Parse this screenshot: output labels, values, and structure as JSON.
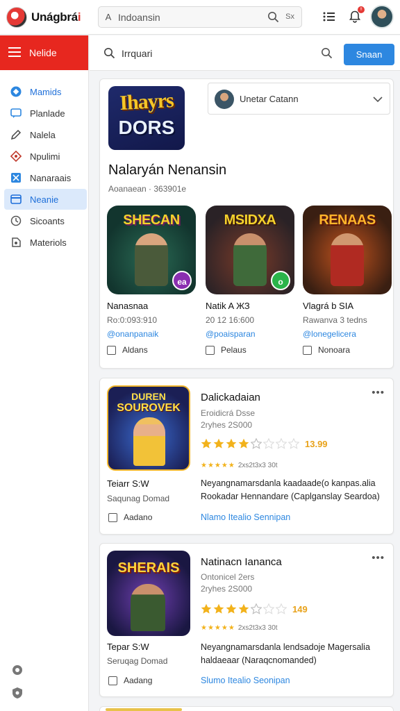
{
  "brand": {
    "name_main": "Unágbrá",
    "name_accent": "i"
  },
  "top_search": {
    "prefix": "A",
    "value": "Indoansin",
    "mini_label": "Sx"
  },
  "notif": {
    "count": "!!"
  },
  "sidebar": {
    "header": "Nelide",
    "items": [
      {
        "label": "Mamids",
        "icon": "diamond-icon",
        "state": "active"
      },
      {
        "label": "Planlade",
        "icon": "chat-icon",
        "state": ""
      },
      {
        "label": "Nalela",
        "icon": "pencil-icon",
        "state": ""
      },
      {
        "label": "Npulimi",
        "icon": "shield-icon",
        "state": ""
      },
      {
        "label": "Nanaraais",
        "icon": "crop-icon",
        "state": ""
      },
      {
        "label": "Neanie",
        "icon": "card-icon",
        "state": "selected"
      },
      {
        "label": "Sicoants",
        "icon": "clock-icon",
        "state": ""
      },
      {
        "label": "Materiols",
        "icon": "tag-icon",
        "state": ""
      }
    ]
  },
  "subbar": {
    "query": "Irrquari",
    "button": "Snaan"
  },
  "featured": {
    "art_line1": "Ihayrs",
    "art_line2": "DORS",
    "selector_label": "Unetar Catann",
    "title": "Nalaryán Nenansin",
    "subtitle": "Aoanaean  ·  363901e",
    "games": [
      {
        "art_label": "SHECAN",
        "name": "Nanasnaa",
        "meta": "Ro:0:093:910",
        "link": "@onanpanaik",
        "check": "Aldans",
        "badge": "ea"
      },
      {
        "art_label": "MSIDXA",
        "name": "Natik A ЖЗ",
        "meta": "20 12 16:600",
        "link": "@poaisparan",
        "check": "Pelaus",
        "badge": "o"
      },
      {
        "art_label": "RENAAS",
        "name": "Vlagrá b SIA",
        "meta": "Rawanva 3 tedns",
        "link": "@lonegelicera",
        "check": "Nonoara",
        "badge": ""
      }
    ]
  },
  "list": [
    {
      "art_label_top": "DUREN",
      "art_label_mid": "SOUROVEK",
      "title": "Dalickadaian",
      "meta1": "Eroidicrá Dsse",
      "meta2": "2ryhes 2S000",
      "rating": "13.99",
      "stars": 4,
      "count": "2xs2t3x3 30t",
      "name": "Teiarr S:W",
      "studio": "Saqunag Domad",
      "desc": "Neyangnamarsdanla kaadaade(o kanpas.alia Rookadar Hennandare (Caplganslay Seardoa)",
      "link": "Nlamo Itealio Sennipan",
      "check": "Aadano"
    },
    {
      "art_label_top": "",
      "art_label_mid": "SHERAIS",
      "title": "Natinacn Iananca",
      "meta1": "Ontonicel 2ers",
      "meta2": "2ryhes 2S000",
      "rating": "149",
      "stars": 4,
      "count": "2xs2t3x3 30t",
      "name": "Tepar S:W",
      "studio": "Seruqag Domad",
      "desc": "Neyangnamarsdanla lendsadoje Magersalia haldaeaar (Naraqcnomanded)",
      "link": "Slumo Itealio Seonipan",
      "check": "Aadang"
    }
  ],
  "colors": {
    "brand_red": "#e7271f",
    "accent_blue": "#2d87e0",
    "star": "#f2b21b"
  }
}
